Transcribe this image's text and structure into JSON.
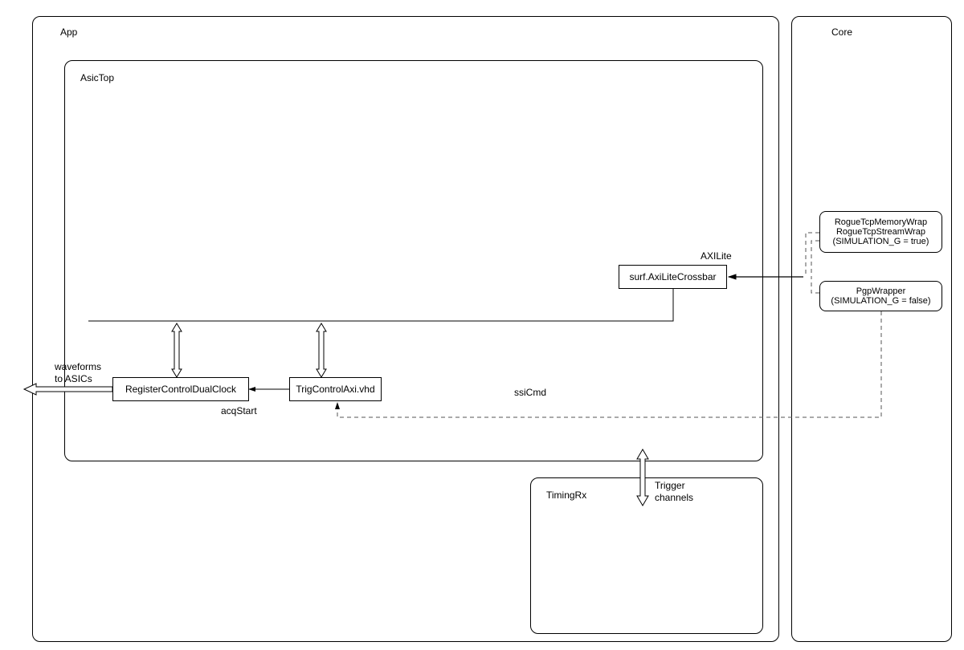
{
  "app": {
    "title": "App",
    "asicTop": {
      "title": "AsicTop",
      "registerControl": "RegisterControlDualClock",
      "trigControl": "TrigControlAxi.vhd",
      "axiLiteCrossbar": "surf.AxiLiteCrossbar",
      "acqStart": "acqStart",
      "ssiCmd": "ssiCmd",
      "waveforms": "waveforms\nto ASICs"
    },
    "timingRx": {
      "title": "TimingRx",
      "triggerChannels": "Trigger\nchannels"
    },
    "axilite": "AXILite"
  },
  "core": {
    "title": "Core",
    "rogue": "RogueTcpMemoryWrap\nRogueTcpStreamWrap\n(SIMULATION_G = true)",
    "pgp": "PgpWrapper\n(SIMULATION_G = false)"
  }
}
